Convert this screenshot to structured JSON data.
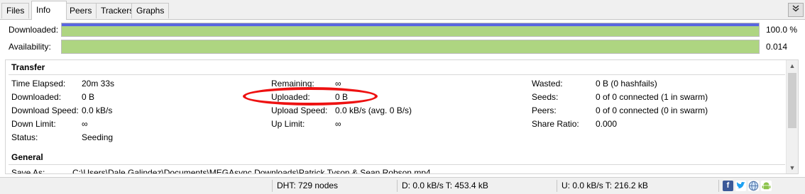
{
  "tabs": [
    {
      "label": "Files"
    },
    {
      "label": "Info"
    },
    {
      "label": "Peers"
    },
    {
      "label": "Trackers"
    },
    {
      "label": "Graphs"
    }
  ],
  "collapse_icon": "chevron-double-down-icon",
  "progress": {
    "downloaded": {
      "label": "Downloaded:",
      "value": "100.0 %",
      "fraction": 1.0
    },
    "availability": {
      "label": "Availability:",
      "value": "0.014",
      "fraction": 1.0
    }
  },
  "colors": {
    "progress_fill": "#aed581",
    "progress_top": "#5a67e0",
    "annotation": "#ee1111"
  },
  "transfer": {
    "title": "Transfer",
    "col1": [
      {
        "label": "Time Elapsed:",
        "value": "20m 33s"
      },
      {
        "label": "Downloaded:",
        "value": "0 B"
      },
      {
        "label": "Download Speed:",
        "value": "0.0 kB/s"
      },
      {
        "label": "Down Limit:",
        "value": "∞"
      },
      {
        "label": "Status:",
        "value": "Seeding"
      }
    ],
    "col2": [
      {
        "label": "Remaining:",
        "value": "∞"
      },
      {
        "label": "Uploaded:",
        "value": "0 B"
      },
      {
        "label": "Upload Speed:",
        "value": "0.0 kB/s (avg. 0 B/s)"
      },
      {
        "label": "Up Limit:",
        "value": "∞"
      }
    ],
    "col3": [
      {
        "label": "Wasted:",
        "value": "0 B (0 hashfails)"
      },
      {
        "label": "Seeds:",
        "value": "0 of 0 connected (1 in swarm)"
      },
      {
        "label": "Peers:",
        "value": "0 of 0 connected (0 in swarm)"
      },
      {
        "label": "Share Ratio:",
        "value": "0.000"
      }
    ]
  },
  "general": {
    "title": "General",
    "save_as_label": "Save As:",
    "save_as_value": "C:\\Users\\Dale Galindez\\Documents\\MEGAsync Downloads\\Patrick Tyson & Sean Robson.mp4"
  },
  "statusbar": {
    "dht": "DHT: 729 nodes",
    "down": "D: 0.0 kB/s T: 453.4 kB",
    "up": "U: 0.0 kB/s T: 216.2 kB",
    "icons": [
      "facebook-icon",
      "twitter-icon",
      "globe-icon",
      "android-icon"
    ]
  }
}
